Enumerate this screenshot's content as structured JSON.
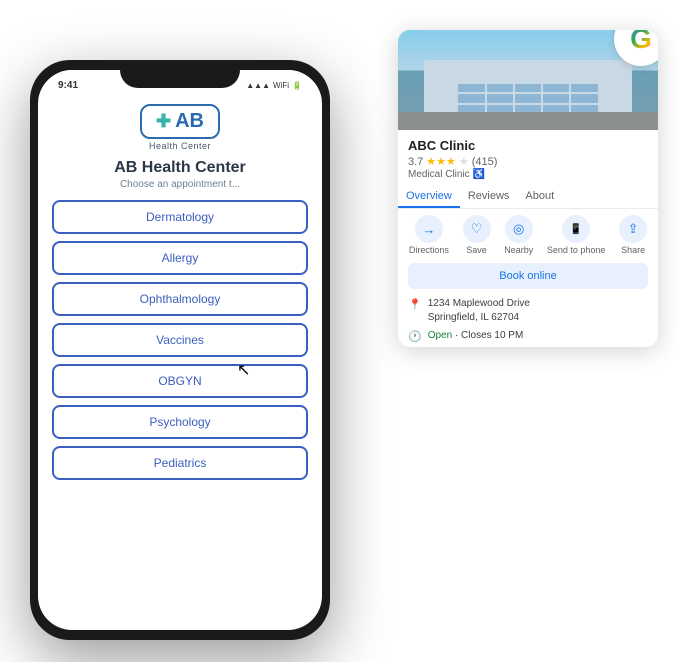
{
  "phone": {
    "logo": {
      "cross": "✚",
      "letters": "AB",
      "subtitle": "Health Center"
    },
    "title": "AB Health Center",
    "subtitle": "Choose an appointment t...",
    "appointments": [
      "Dermatology",
      "Allergy",
      "Ophthalmology",
      "Vaccines",
      "OBGYN",
      "Psychology",
      "Pediatrics"
    ]
  },
  "google_card": {
    "clinic_name": "ABC Clinic",
    "rating": "3.7",
    "rating_count": "(415)",
    "type": "Medical Clinic",
    "tabs": [
      "Overview",
      "Reviews",
      "About"
    ],
    "active_tab": "Overview",
    "actions": [
      {
        "label": "Directions",
        "icon": "→"
      },
      {
        "label": "Save",
        "icon": "♡"
      },
      {
        "label": "Nearby",
        "icon": "◎"
      },
      {
        "label": "Send to phone",
        "icon": "📱"
      },
      {
        "label": "Share",
        "icon": "⇪"
      }
    ],
    "book_btn": "Book online",
    "address": "1234 Maplewood Drive\nSpringfield, IL 62704",
    "hours": "Open · Closes 10 PM",
    "google_g": "G"
  }
}
